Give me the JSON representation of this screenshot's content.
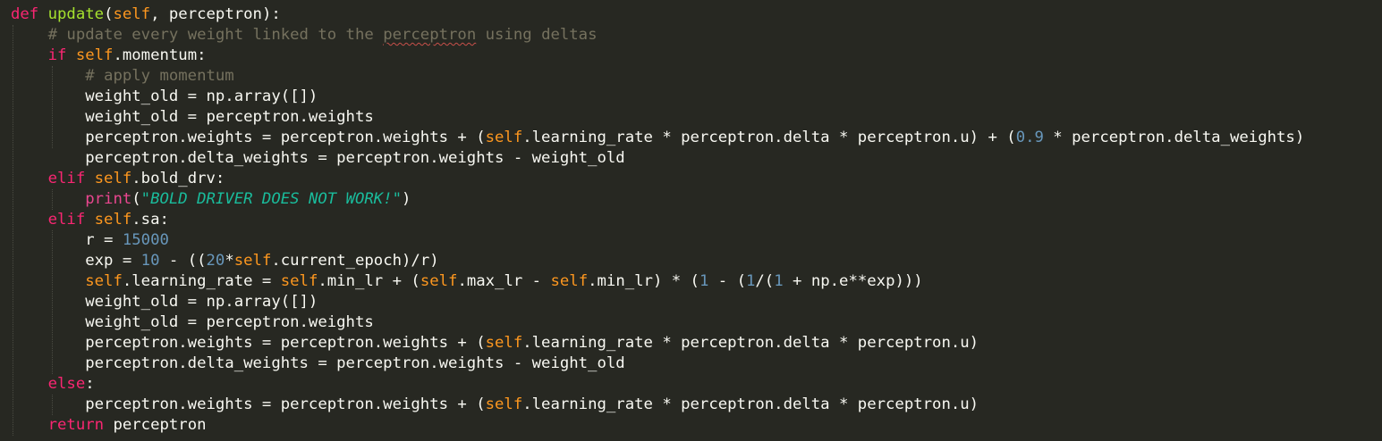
{
  "code_lines": [
    [
      [
        "kw",
        "def"
      ],
      [
        "p",
        " "
      ],
      [
        "fn",
        "update"
      ],
      [
        "p",
        "("
      ],
      [
        "self",
        "self"
      ],
      [
        "p",
        ", perceptron):"
      ]
    ],
    [
      [
        "p",
        "    "
      ],
      [
        "cmt",
        "# update every weight linked to the "
      ],
      [
        "cmtsq",
        "perceptron"
      ],
      [
        "cmt",
        " using deltas"
      ]
    ],
    [
      [
        "p",
        "    "
      ],
      [
        "kw",
        "if"
      ],
      [
        "p",
        " "
      ],
      [
        "self",
        "self"
      ],
      [
        "p",
        ".momentum:"
      ]
    ],
    [
      [
        "p",
        "        "
      ],
      [
        "cmt",
        "# apply momentum"
      ]
    ],
    [
      [
        "p",
        "        weight_old = np.array([])"
      ]
    ],
    [
      [
        "p",
        "        weight_old = perceptron.weights"
      ]
    ],
    [
      [
        "p",
        "        perceptron.weights = perceptron.weights + ("
      ],
      [
        "self",
        "self"
      ],
      [
        "p",
        ".learning_rate * perceptron.delta * perceptron.u) + ("
      ],
      [
        "num",
        "0.9"
      ],
      [
        "p",
        " * perceptron.delta_weights)"
      ]
    ],
    [
      [
        "p",
        "        perceptron.delta_weights = perceptron.weights - weight_old"
      ]
    ],
    [
      [
        "p",
        "    "
      ],
      [
        "kw",
        "elif"
      ],
      [
        "p",
        " "
      ],
      [
        "self",
        "self"
      ],
      [
        "p",
        ".bold_drv:"
      ]
    ],
    [
      [
        "p",
        "        "
      ],
      [
        "bi",
        "print"
      ],
      [
        "p",
        "("
      ],
      [
        "str",
        "\"BOLD DRIVER DOES NOT WORK!\""
      ],
      [
        "p",
        ")"
      ]
    ],
    [
      [
        "p",
        "    "
      ],
      [
        "kw",
        "elif"
      ],
      [
        "p",
        " "
      ],
      [
        "self",
        "self"
      ],
      [
        "p",
        ".sa:"
      ]
    ],
    [
      [
        "p",
        "        r = "
      ],
      [
        "num",
        "15000"
      ]
    ],
    [
      [
        "p",
        "        exp = "
      ],
      [
        "num",
        "10"
      ],
      [
        "p",
        " - (("
      ],
      [
        "num",
        "20"
      ],
      [
        "p",
        "*"
      ],
      [
        "self",
        "self"
      ],
      [
        "p",
        ".current_epoch)/r)"
      ]
    ],
    [
      [
        "p",
        "        "
      ],
      [
        "self",
        "self"
      ],
      [
        "p",
        ".learning_rate = "
      ],
      [
        "self",
        "self"
      ],
      [
        "p",
        ".min_lr + ("
      ],
      [
        "self",
        "self"
      ],
      [
        "p",
        ".max_lr - "
      ],
      [
        "self",
        "self"
      ],
      [
        "p",
        ".min_lr) * ("
      ],
      [
        "num",
        "1"
      ],
      [
        "p",
        " - ("
      ],
      [
        "num",
        "1"
      ],
      [
        "p",
        "/("
      ],
      [
        "num",
        "1"
      ],
      [
        "p",
        " + np.e**exp)))"
      ]
    ],
    [
      [
        "p",
        "        weight_old = np.array([])"
      ]
    ],
    [
      [
        "p",
        "        weight_old = perceptron.weights"
      ]
    ],
    [
      [
        "p",
        "        perceptron.weights = perceptron.weights + ("
      ],
      [
        "self",
        "self"
      ],
      [
        "p",
        ".learning_rate * perceptron.delta * perceptron.u)"
      ]
    ],
    [
      [
        "p",
        "        perceptron.delta_weights = perceptron.weights - weight_old"
      ]
    ],
    [
      [
        "p",
        "    "
      ],
      [
        "kw",
        "else"
      ],
      [
        "p",
        ":"
      ]
    ],
    [
      [
        "p",
        "        perceptron.weights = perceptron.weights + ("
      ],
      [
        "self",
        "self"
      ],
      [
        "p",
        ".learning_rate * perceptron.delta * perceptron.u)"
      ]
    ],
    [
      [
        "p",
        "    "
      ],
      [
        "kw",
        "return"
      ],
      [
        "p",
        " perceptron"
      ]
    ]
  ],
  "colors": {
    "background": "#272822",
    "plain": "#f8f8f2",
    "keyword": "#f92672",
    "function_name": "#a6e22e",
    "self": "#fd971f",
    "number": "#6897bb",
    "comment": "#75715e",
    "string": "#1abc9c",
    "spellcheck_underline": "#c8504a"
  }
}
